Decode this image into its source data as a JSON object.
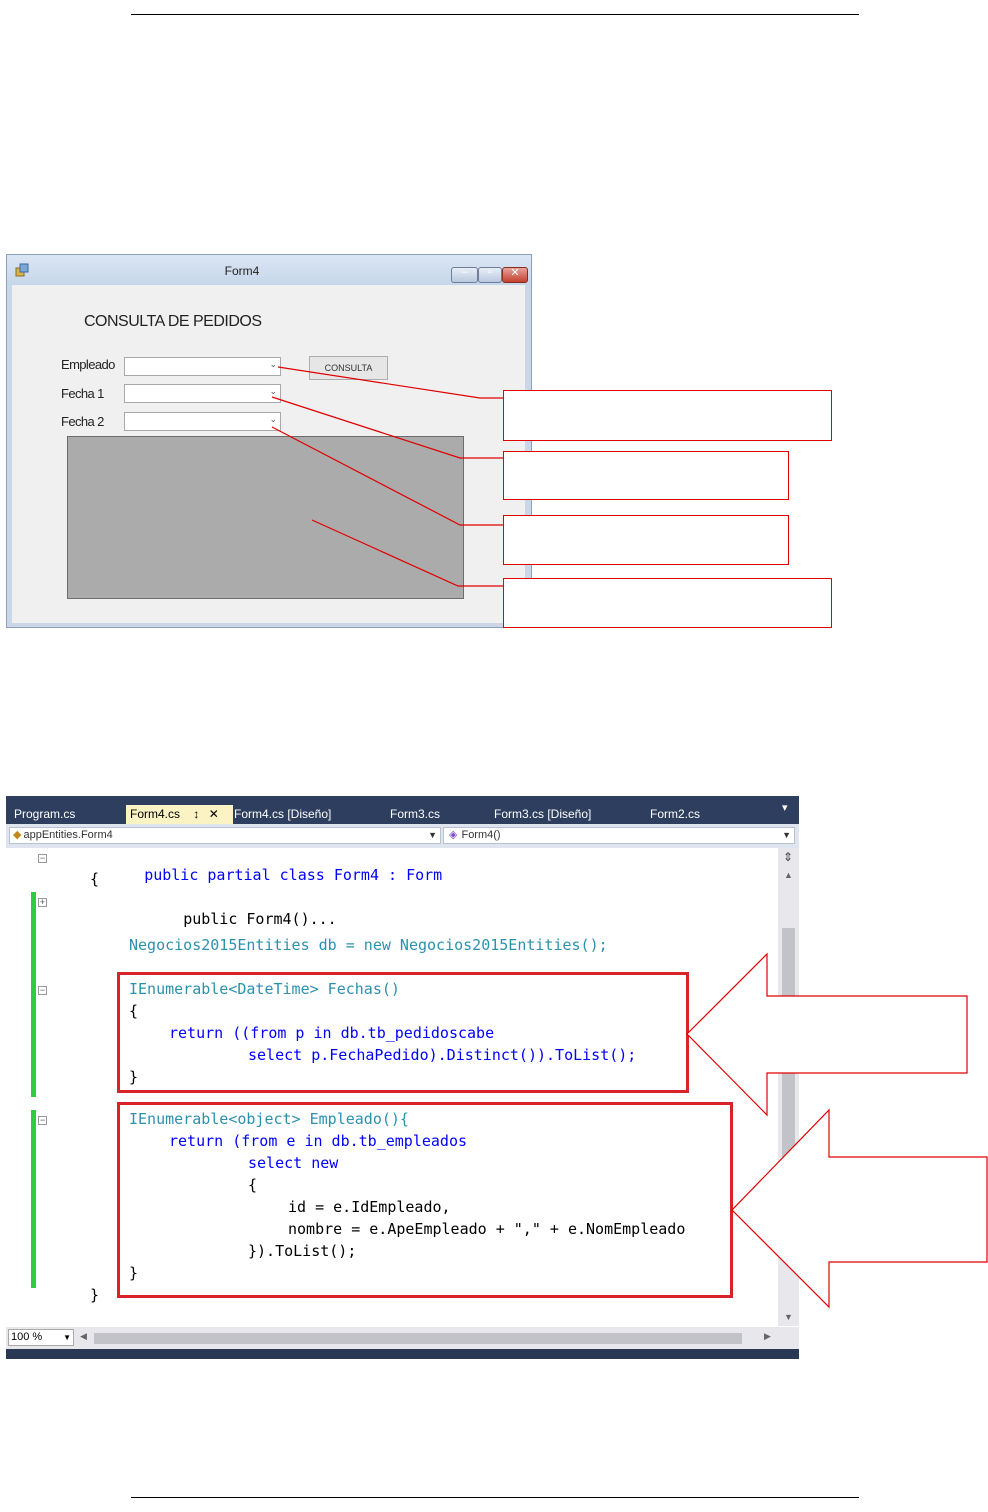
{
  "form": {
    "title": "Form4",
    "heading": "CONSULTA DE PEDIDOS",
    "labels": {
      "empleado": "Empleado",
      "fecha1": "Fecha 1",
      "fecha2": "Fecha 2"
    },
    "consulta_button": "CONSULTA",
    "dropdown_glyph": "⌄"
  },
  "vs": {
    "tabs": [
      "Program.cs",
      "Form4.cs",
      "Form4.cs [Diseño]",
      "Form3.cs",
      "Form3.cs [Diseño]",
      "Form2.cs"
    ],
    "active_tab": "Form4.cs",
    "pin_glyph": "↕",
    "close_glyph": "✕",
    "nav_left": "appEntities.Form4",
    "nav_right": "Form4()",
    "zoom": "100 %",
    "code_lines": [
      "public partial class Form4 : Form",
      "{",
      "public Form4()...",
      "Negocios2015Entities db = new Negocios2015Entities();",
      "IEnumerable<DateTime> Fechas()",
      "{",
      "return ((from p in db.tb_pedidoscabe",
      "select p.FechaPedido).Distinct()).ToList();",
      "}",
      "IEnumerable<object> Empleado(){",
      "return (from e in db.tb_empleados",
      "select new",
      "{",
      "id = e.IdEmpleado,",
      "nombre = e.ApeEmpleado + \",\" + e.NomEmpleado",
      "}).ToList();",
      "}",
      "}"
    ]
  },
  "colors": {
    "annotation_red": "#e00000",
    "keyword": "#0000ff",
    "type": "#2b91af",
    "string": "#a31515"
  }
}
